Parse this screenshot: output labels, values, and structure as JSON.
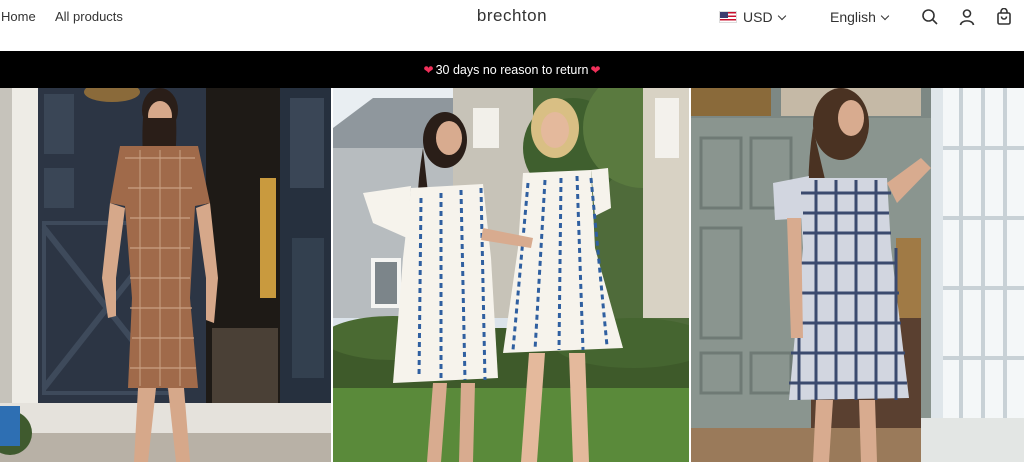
{
  "header": {
    "nav": [
      {
        "label": "Home"
      },
      {
        "label": "All products"
      }
    ],
    "brand": "brechton",
    "currency": {
      "code": "USD",
      "flag_icon": "us-flag-icon"
    },
    "language": {
      "label": "English"
    },
    "icons": [
      "search-icon",
      "account-icon",
      "cart-icon"
    ]
  },
  "announcement": {
    "text": "30 days no reason to return",
    "icon": "heart-icon",
    "icon_color": "#f0305a"
  },
  "gallery": {
    "tiles": [
      {
        "subject": "brown-checked-dress"
      },
      {
        "subject": "blue-white-floral-dresses"
      },
      {
        "subject": "plaid-dress"
      }
    ]
  }
}
